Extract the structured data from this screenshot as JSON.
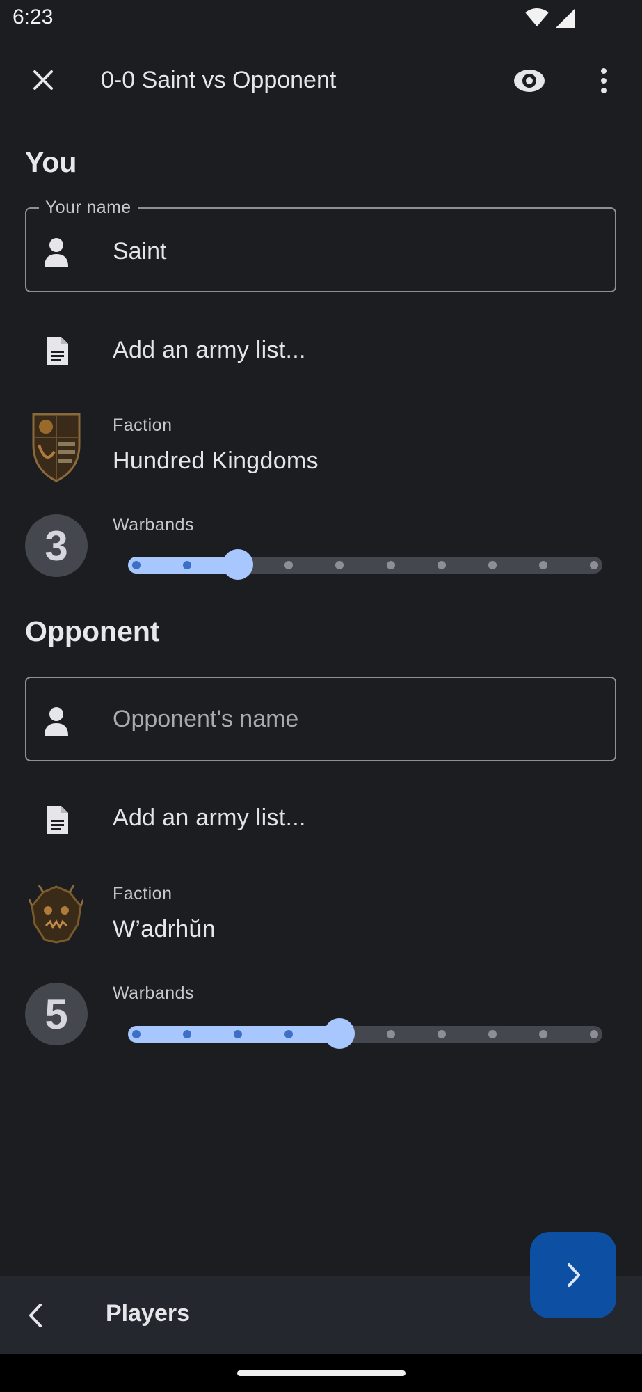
{
  "status_bar": {
    "time": "6:23"
  },
  "app_bar": {
    "title": "0-0 Saint vs Opponent",
    "icons": [
      "close-icon",
      "eye-icon",
      "more-vert-icon"
    ]
  },
  "you": {
    "heading": "You",
    "name_field": {
      "label": "Your name",
      "value": "Saint"
    },
    "army_list_label": "Add an army list...",
    "faction_label": "Faction",
    "faction_value": "Hundred Kingdoms",
    "warbands_label": "Warbands",
    "warbands_value": "3",
    "warbands_level": 3,
    "warbands_max": 10
  },
  "opponent": {
    "heading": "Opponent",
    "name_field": {
      "placeholder": "Opponent's name",
      "value": ""
    },
    "army_list_label": "Add an army list...",
    "faction_label": "Faction",
    "faction_value": "W’adrhŭn",
    "warbands_label": "Warbands",
    "warbands_value": "5",
    "warbands_level": 5,
    "warbands_max": 10
  },
  "bottom_bar": {
    "title": "Players"
  },
  "colors": {
    "background": "#1c1d20",
    "accent": "#a9c7ff",
    "fab": "#0d4fa3",
    "bottom_bar": "#24272e"
  }
}
